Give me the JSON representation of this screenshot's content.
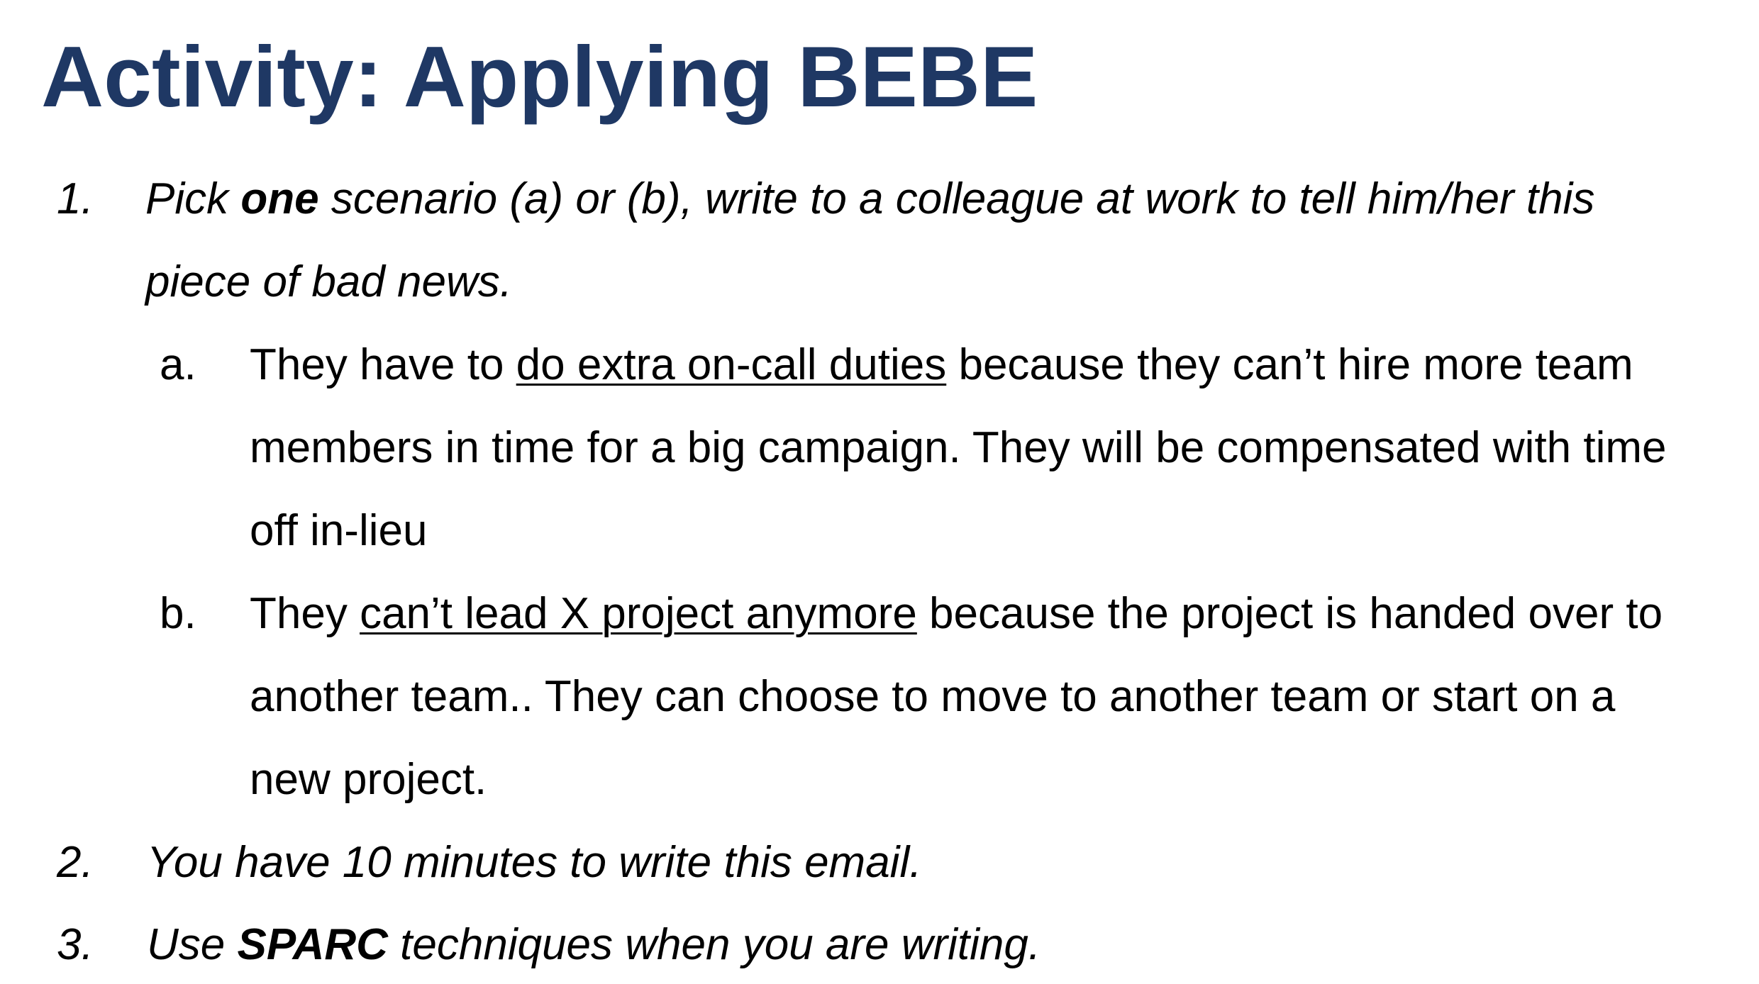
{
  "slide": {
    "title": "Activity: Applying BEBE",
    "items": [
      {
        "number": "1.",
        "line1": {
          "pre": "Pick ",
          "bold": "one",
          "post": " scenario (a) or (b), write to a colleague at work to tell him/her this"
        },
        "line2": "piece of bad news.",
        "sub_items": [
          {
            "letter": "a.",
            "line1": {
              "pre": "They have to ",
              "underlined": "do extra on-call duties",
              "post": " because they can’t hire more team"
            },
            "line2": "members in time for a big campaign. They will be compensated with time",
            "line3": "off in-lieu"
          },
          {
            "letter": "b.",
            "line1": {
              "pre": "They ",
              "underlined": "can’t lead X project anymore",
              "post": " because the project is handed over to"
            },
            "line2": "another team.. They can choose to move to another team or start on a",
            "line3": "new project."
          }
        ]
      },
      {
        "number": "2.",
        "text": "You have 10 minutes to write this email."
      },
      {
        "number": "3.",
        "line1": {
          "pre": "Use ",
          "bold": "SPARC",
          "post": " techniques when you are writing."
        }
      }
    ],
    "colors": {
      "title": "#1f3864",
      "body": "#000000",
      "background": "#ffffff"
    }
  }
}
